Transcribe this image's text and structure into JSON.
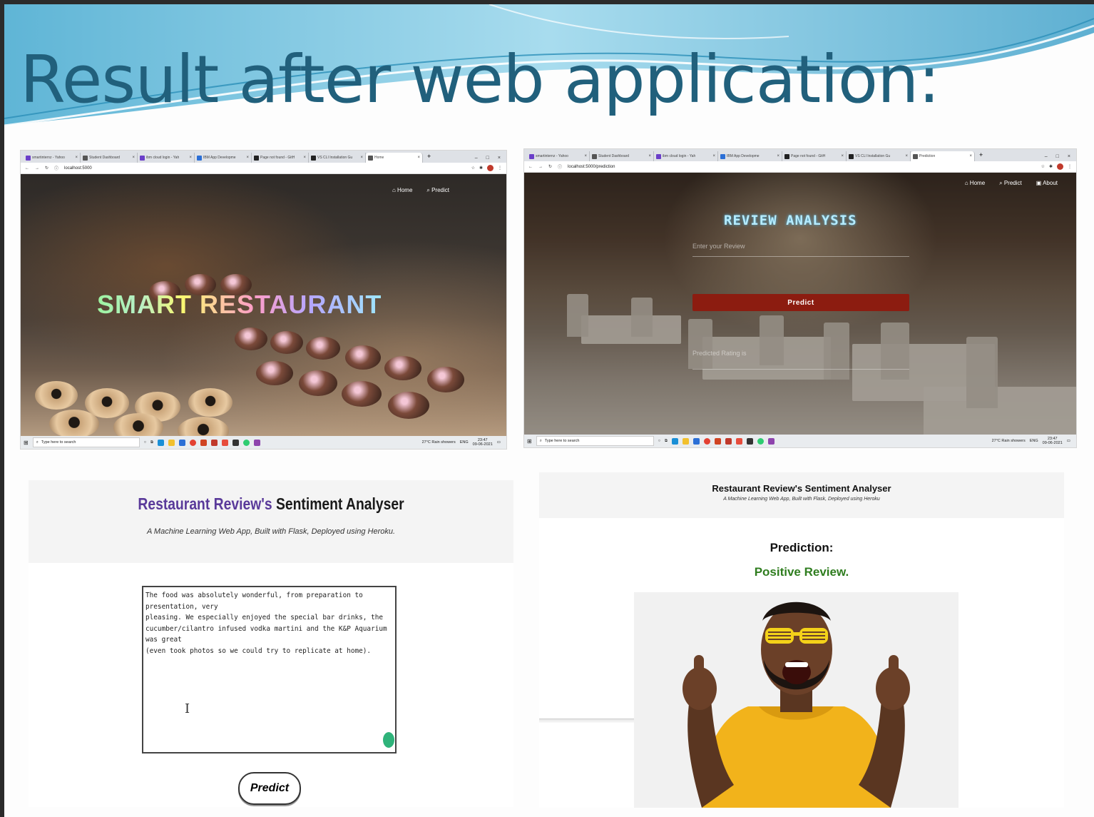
{
  "slide": {
    "title": "Result after web application:"
  },
  "shot1": {
    "tabs": [
      {
        "label": "smartinternz - Yahoo",
        "color": "#6b3fc9"
      },
      {
        "label": "Student Dashboard",
        "color": "#555555"
      },
      {
        "label": "ibm cloud login - Yah",
        "color": "#6b3fc9"
      },
      {
        "label": "IBM App Developme",
        "color": "#2b6fd6"
      },
      {
        "label": "Page not found - GitH",
        "color": "#222222"
      },
      {
        "label": "VS CLI Installation Gu",
        "color": "#222222"
      },
      {
        "label": "Home",
        "color": "#555555"
      }
    ],
    "url": "localhost:5000",
    "nav": {
      "home": "Home",
      "predict": "Predict"
    },
    "hero_title": "SMART RESTAURANT"
  },
  "shot2": {
    "tabs": [
      {
        "label": "smartinternz - Yahoo",
        "color": "#6b3fc9"
      },
      {
        "label": "Student Dashboard",
        "color": "#555555"
      },
      {
        "label": "ibm cloud login - Yah",
        "color": "#6b3fc9"
      },
      {
        "label": "IBM App Developme",
        "color": "#2b6fd6"
      },
      {
        "label": "Page not found - GitH",
        "color": "#222222"
      },
      {
        "label": "VS CLI Installation Gu",
        "color": "#222222"
      },
      {
        "label": "Prediction",
        "color": "#555555"
      }
    ],
    "url": "localhost:5000/prediction",
    "nav": {
      "home": "Home",
      "predict": "Predict",
      "about": "About"
    },
    "heading": "REVIEW ANALYSIS",
    "input_placeholder": "Enter your Review",
    "predict_button": "Predict",
    "predicted_label": "Predicted Rating is"
  },
  "taskbar": {
    "search_placeholder": "Type here to search",
    "weather": "27°C  Rain showers",
    "lang": "ENG",
    "time": "23:47",
    "date": "09-06-2021"
  },
  "panel3": {
    "title_part1": "Restaurant Review's",
    "title_part2": " Sentiment Analyser",
    "subtitle": "A Machine Learning Web App, Built with Flask, Deployed using Heroku.",
    "review_text": "The food was absolutely wonderful, from preparation to presentation, very\npleasing. We especially enjoyed the special bar drinks, the\ncucumber/cilantro infused vodka martini and the K&P Aquarium was great\n(even took photos so we could try to replicate at home).",
    "predict_button": "Predict"
  },
  "panel4": {
    "title": "Restaurant Review's Sentiment Analyser",
    "subtitle": "A Machine Learning Web App, Built with Flask, Deployed using Heroku",
    "prediction_label": "Prediction:",
    "prediction_result": "Positive Review.",
    "result_color": "#2f7d1f"
  }
}
